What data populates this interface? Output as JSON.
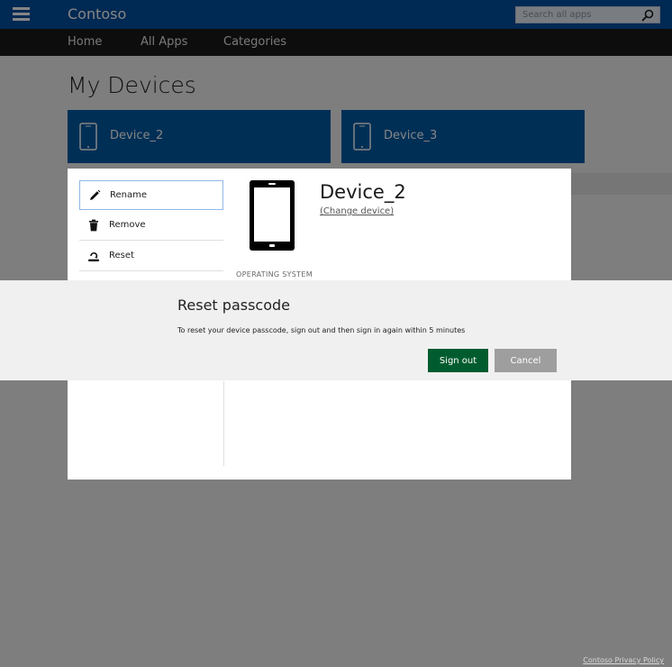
{
  "header": {
    "brand": "Contoso",
    "search_placeholder": "Search all apps"
  },
  "nav": {
    "items": [
      "Home",
      "All Apps",
      "Categories"
    ]
  },
  "main": {
    "title": "My Devices",
    "devices": [
      {
        "name": "Device_2"
      },
      {
        "name": "Device_3"
      }
    ]
  },
  "detail_panel": {
    "menu": [
      {
        "label": "Rename",
        "icon": "pencil-icon"
      },
      {
        "label": "Remove",
        "icon": "trash-icon"
      },
      {
        "label": "Reset",
        "icon": "reset-icon"
      }
    ],
    "device_name": "Device_2",
    "change_device_label": "(Change device)",
    "os_label": "OPERATING SYSTEM"
  },
  "dialog": {
    "title": "Reset passcode",
    "message": "To reset your device passcode, sign out and then sign in again within 5 minutes",
    "primary_label": "Sign out",
    "secondary_label": "Cancel"
  },
  "footer": {
    "privacy_label": "Contoso Privacy Policy"
  },
  "colors": {
    "header_blue": "#0050a0",
    "tile_blue": "#005aa6",
    "nav_dark": "#1a1a1a",
    "primary_green": "#005c2f",
    "secondary_gray": "#9e9e9e"
  }
}
